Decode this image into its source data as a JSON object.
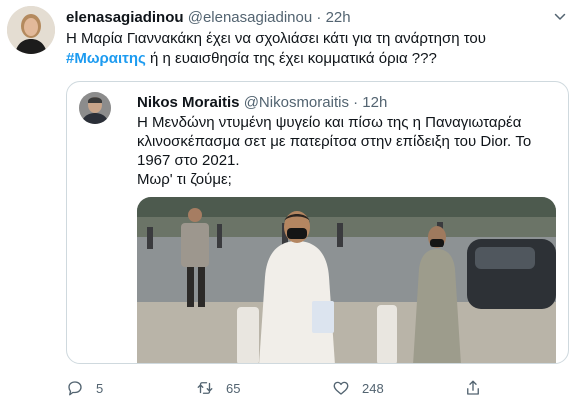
{
  "tweet": {
    "author_name": "elenasagiadinou",
    "author_handle": "@elenasagiadinou",
    "separator": "·",
    "time": "22h",
    "text_part1": "Η Μαρία Γιαννακάκη έχει να σχολιάσει κάτι για τη ανάρτηση του ",
    "hashtag": "#Μωραιτης",
    "text_part2": " ή η ευαισθησία της έχει κομματικά όρια  ???"
  },
  "quoted": {
    "author_name": "Nikos Moraitis",
    "author_handle": "@Nikosmoraitis",
    "separator": "·",
    "time": "12h",
    "line1": "Η Μενδώνη ντυμένη ψυγείο και πίσω της η Παναγιωταρέα κλινοσκέπασμα σετ με πατερίτσα στην επίδειξη του Dior. Το 1967 στο 2021.",
    "line2": "Μωρ' τι ζούμε;"
  },
  "actions": {
    "reply_count": "5",
    "retweet_count": "65",
    "like_count": "248"
  },
  "colors": {
    "accent": "#1d9bf0",
    "text": "#0f1419",
    "muted": "#536471",
    "border": "#cfd9de"
  },
  "icons": [
    "more-icon",
    "reply-icon",
    "retweet-icon",
    "like-icon",
    "share-icon"
  ]
}
